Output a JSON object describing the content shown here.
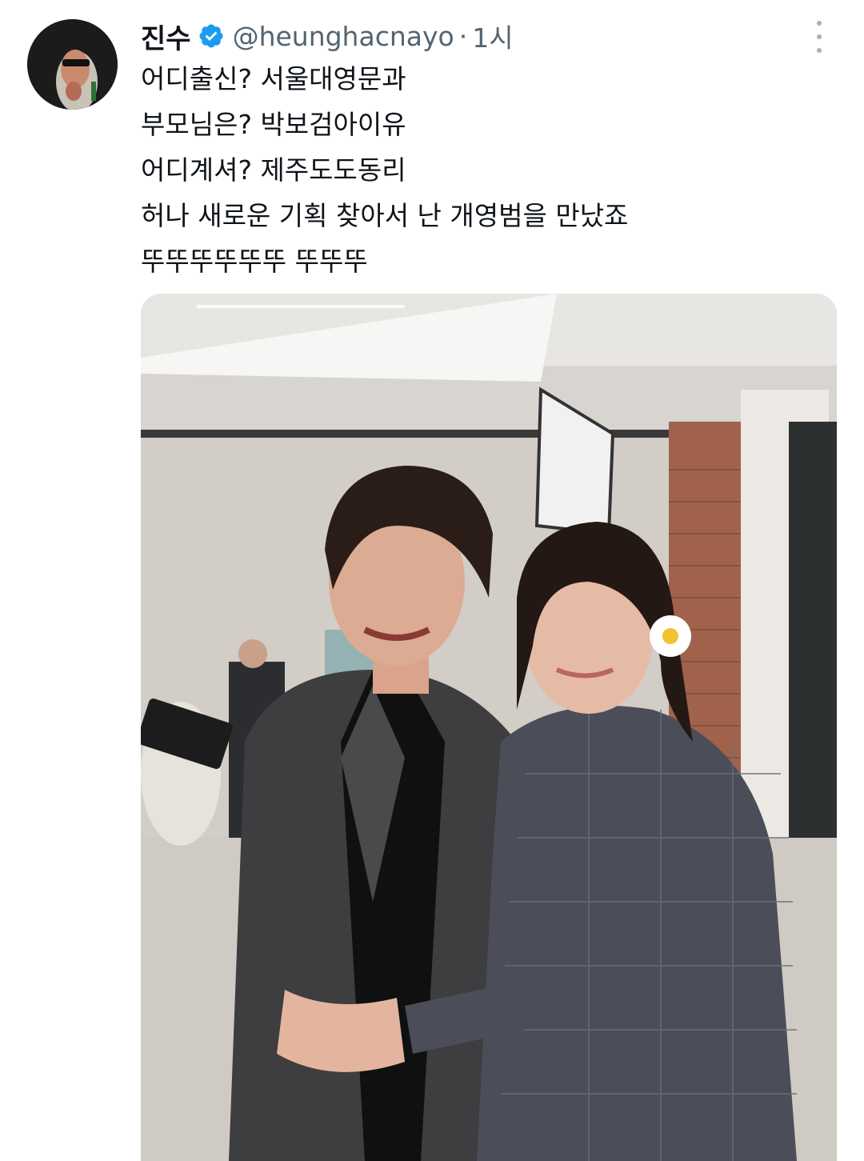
{
  "tweet": {
    "author": {
      "display_name": "진수",
      "handle": "@heunghacnayo",
      "verified": true,
      "avatar_icon": "avatar-image"
    },
    "separator": "·",
    "timestamp": "1시",
    "text_lines": [
      "어디출신? 서울대영문과",
      "부모님은? 박보검아이유",
      "어디계셔? 제주도도동리",
      "허나 새로운 기획 찾아서 난 개영범을 만났죠",
      "뚜뚜뚜뚜뚜뚜 뚜뚜뚜"
    ],
    "more_icon": "more-vertical-icon",
    "media": {
      "type": "photo",
      "icon": "photo-image"
    }
  },
  "colors": {
    "text_primary": "#0f1419",
    "text_secondary": "#536471",
    "verified_badge": "#1d9bf0",
    "more_dots": "#a6b1ba"
  }
}
